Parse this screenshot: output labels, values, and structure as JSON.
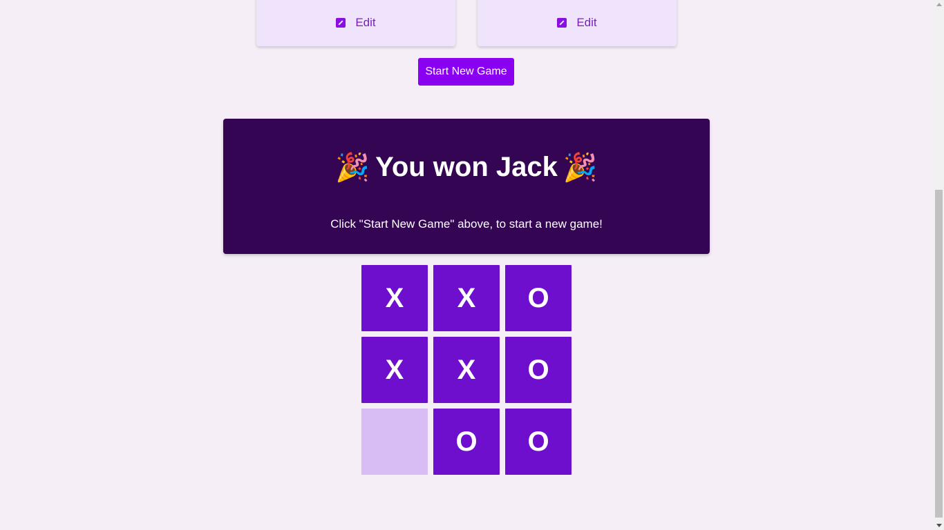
{
  "players": [
    {
      "edit_label": "Edit",
      "icon": "edit-icon"
    },
    {
      "edit_label": "Edit",
      "icon": "edit-icon"
    }
  ],
  "controls": {
    "start_new_game_label": "Start New Game"
  },
  "result": {
    "party_icon": "🎉",
    "title": "You won Jack",
    "subtitle": "Click \"Start New Game\" above, to start a new game!"
  },
  "board": {
    "cells": [
      "X",
      "X",
      "O",
      "X",
      "X",
      "O",
      "",
      "O",
      "O"
    ]
  },
  "colors": {
    "background": "#f5eef7",
    "card": "#f0e4fc",
    "accent": "#8a00f0",
    "banner": "#330552",
    "cell_filled": "#6d0fcc",
    "cell_empty": "#d8bdf5"
  }
}
